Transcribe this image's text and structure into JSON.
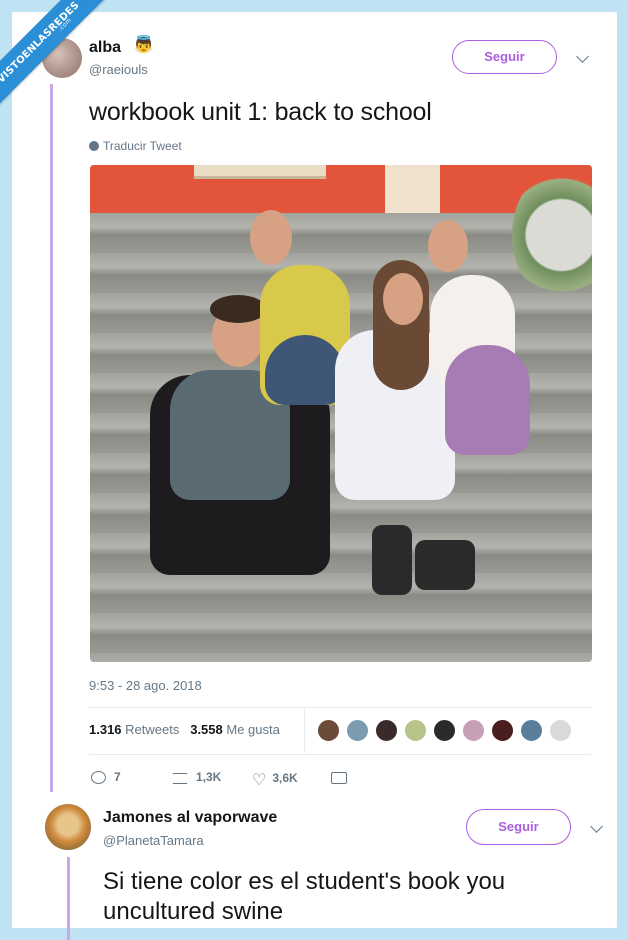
{
  "watermark": {
    "text": "VISTOENLASREDES",
    "sub": ".com"
  },
  "tweet": {
    "author": {
      "name": "alba",
      "emoji": "👼",
      "handle": "@raeiouls"
    },
    "follow_label": "Seguir",
    "text": "workbook unit 1: back to school",
    "translate_label": "Traducir Tweet",
    "timestamp": "9:53 - 28 ago. 2018",
    "stats": {
      "retweets_count": "1.316",
      "retweets_label": "Retweets",
      "likes_count": "3.558",
      "likes_label": "Me gusta"
    },
    "liker_colors": [
      "#6b4b3a",
      "#7a9bb0",
      "#3b2a2a",
      "#b6c48a",
      "#2a2a2a",
      "#c7a0b7",
      "#4a1e1e",
      "#5a7d9a",
      "#d9d9d9"
    ],
    "actions": {
      "reply_count": "7",
      "retweet_count": "1,3K",
      "like_count": "3,6K"
    }
  },
  "reply": {
    "author": {
      "name": "Jamones al vaporwave",
      "handle": "@PlanetaTamara"
    },
    "follow_label": "Seguir",
    "text": "Si tiene color es el student's book you uncultured swine"
  },
  "colors": {
    "accent": "#a95fe0",
    "thread": "#c9a6e8",
    "ribbon": "#2a8fd6",
    "background": "#bfe3f2"
  }
}
